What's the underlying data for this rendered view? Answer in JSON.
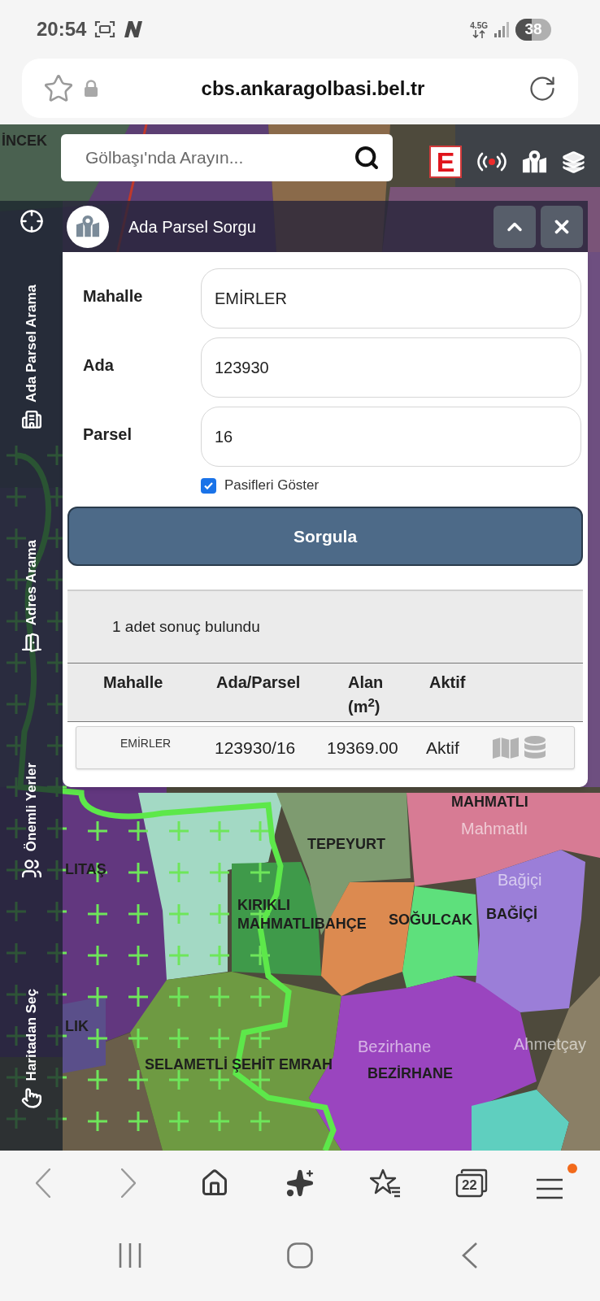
{
  "status_bar": {
    "time": "20:54",
    "network": "4.5G",
    "battery": "38"
  },
  "browser": {
    "url": "cbs.ankaragolbasi.bel.tr"
  },
  "map_toolbar": {
    "search": {
      "placeholder": "Gölbaşı'nda Arayın..."
    },
    "logo": "E"
  },
  "sidebar": {
    "items": [
      {
        "label": "Ada Parsel Arama",
        "kind": "building"
      },
      {
        "label": "Adres Arama",
        "kind": "address"
      },
      {
        "label": "Önemli Yerler",
        "kind": "places"
      },
      {
        "label": "Haritadan Seç",
        "kind": "pick"
      }
    ]
  },
  "panel": {
    "title": "Ada Parsel Sorgu",
    "fields": [
      {
        "label": "Mahalle",
        "value": "EMİRLER"
      },
      {
        "label": "Ada",
        "value": "123930"
      },
      {
        "label": "Parsel",
        "value": "16"
      }
    ],
    "checkbox": {
      "label": "Pasifleri Göster",
      "checked": true
    },
    "button": "Sorgula",
    "results": {
      "summary": "1 adet sonuç bulundu",
      "columns": [
        "Mahalle",
        "Ada/Parsel",
        "Alan (m$^{2}$)",
        "Aktif"
      ],
      "rows": [
        {
          "cells": [
            "EMİRLER",
            "123930/16",
            "19369.00",
            "Aktif"
          ]
        }
      ]
    }
  },
  "map_labels": [
    {
      "text": "İNCEK",
      "kind": "district"
    },
    {
      "text": "MAHMATLI",
      "kind": "district"
    },
    {
      "text": "Mahmatlı",
      "kind": "place"
    },
    {
      "text": "LITAŞ",
      "kind": "district"
    },
    {
      "text": "TEPEYURT",
      "kind": "district"
    },
    {
      "text": "Bağiçi",
      "kind": "place"
    },
    {
      "text": "KIRIKLI MAHMATLIBAHÇE",
      "kind": "district"
    },
    {
      "text": "SOĞULCAK",
      "kind": "district"
    },
    {
      "text": "BAĞİÇİ",
      "kind": "district"
    },
    {
      "text": "LIK",
      "kind": "district"
    },
    {
      "text": "Ahmetçay",
      "kind": "place"
    },
    {
      "text": "Bezirhane",
      "kind": "place"
    },
    {
      "text": "SELAMETLİ ŞEHİT EMRAH",
      "kind": "district"
    },
    {
      "text": "BEZİRHANE",
      "kind": "district"
    }
  ],
  "browser_nav": {
    "tabs_count": "22",
    "menu_badge": true
  }
}
